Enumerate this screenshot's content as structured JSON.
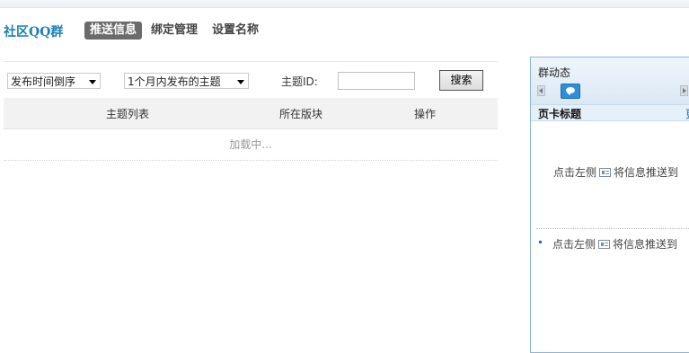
{
  "header": {
    "brand": "社区QQ群",
    "tabs": [
      {
        "label": "推送信息",
        "active": true
      },
      {
        "label": "绑定管理",
        "active": false
      },
      {
        "label": "设置名称",
        "active": false
      }
    ]
  },
  "filters": {
    "sort_select": "发布时间倒序",
    "range_select": "1个月内发布的主题",
    "topic_id_label": "主题ID:",
    "topic_id_value": "",
    "search_button": "搜索"
  },
  "table": {
    "columns": [
      "主题列表",
      "所在版块",
      "操作"
    ],
    "loading_text": "加载中..."
  },
  "panel": {
    "title": "群动态",
    "card_title": "页卡标题",
    "card_more": "更",
    "hint_prefix": "点击左侧",
    "hint_suffix": "将信息推送到",
    "hint_prefix_2": "点击左侧",
    "hint_suffix_2": "将信息推送到",
    "icons": [
      "chevron-left-icon",
      "chat-bubble-icon",
      "chevron-right-icon",
      "card-icon"
    ]
  },
  "colors": {
    "brand": "#1a7fb2",
    "active_tab_bg": "#6b6b6b",
    "panel_border": "#8fb6d6"
  }
}
